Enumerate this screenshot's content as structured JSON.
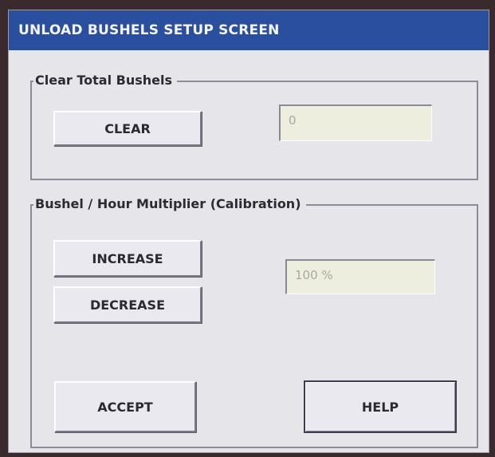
{
  "window": {
    "title": "UNLOAD BUSHELS SETUP SCREEN"
  },
  "clear_group": {
    "legend": "Clear Total Bushels",
    "clear_label": "CLEAR",
    "total_value": "0"
  },
  "calibration_group": {
    "legend": "Bushel / Hour Multiplier (Calibration)",
    "increase_label": "INCREASE",
    "decrease_label": "DECREASE",
    "multiplier_value": "100 %"
  },
  "footer": {
    "accept_label": "ACCEPT",
    "help_label": "HELP"
  },
  "colors": {
    "titlebar": "#2a4f9e",
    "panel": "#e6e5ea",
    "field": "#eeeede"
  }
}
